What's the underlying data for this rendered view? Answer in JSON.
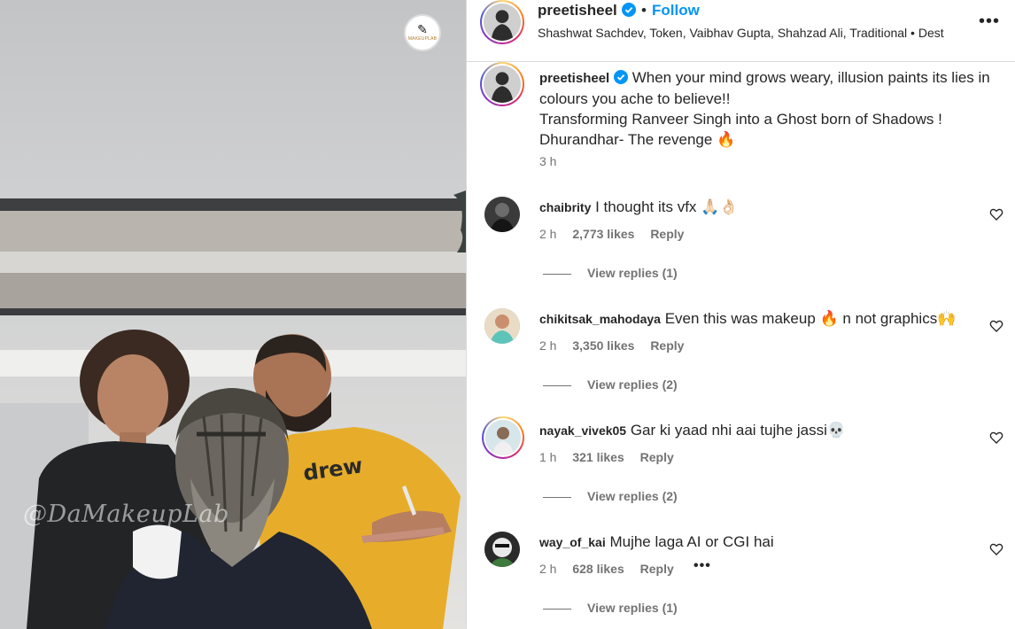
{
  "post": {
    "author": "preetisheel",
    "follow_label": "Follow",
    "separator": "•",
    "audio": "Shashwat Sachdev, Token, Vaibhav Gupta, Shahzad Ali, Traditional • Dest",
    "more_icon": "more-horizontal-icon"
  },
  "media": {
    "watermark_handle": "@DaMakeupLab",
    "logo_text": "MAKEUPLAB"
  },
  "caption": {
    "author": "preetisheel",
    "line1": "When your mind grows weary, illusion paints its lies in colours you ache to believe!!",
    "line2": "Transforming Ranveer Singh into a Ghost born of Shadows !",
    "line3": "Dhurandhar- The revenge 🔥",
    "time": "3 h"
  },
  "comments": [
    {
      "user": "chaibrity",
      "text": "I thought its vfx 🙏🏻👌🏻",
      "time": "2 h",
      "likes": "2,773 likes",
      "reply": "Reply",
      "view_replies": "View replies (1)"
    },
    {
      "user": "chikitsak_mahodaya",
      "text": "Even this was makeup 🔥 n not graphics🙌",
      "time": "2 h",
      "likes": "3,350 likes",
      "reply": "Reply",
      "view_replies": "View replies (2)"
    },
    {
      "user": "nayak_vivek05",
      "text": "Gar ki yaad nhi aai tujhe jassi💀",
      "time": "1 h",
      "likes": "321 likes",
      "reply": "Reply",
      "view_replies": "View replies (2)"
    },
    {
      "user": "way_of_kai",
      "text": "Mujhe laga AI or CGI hai",
      "time": "2 h",
      "likes": "628 likes",
      "reply": "Reply",
      "more": "•••",
      "view_replies": "View replies (1)"
    }
  ],
  "colors": {
    "link_blue": "#0095f6",
    "text_primary": "#262626",
    "text_secondary": "#737373",
    "border": "#dbdbdb"
  }
}
